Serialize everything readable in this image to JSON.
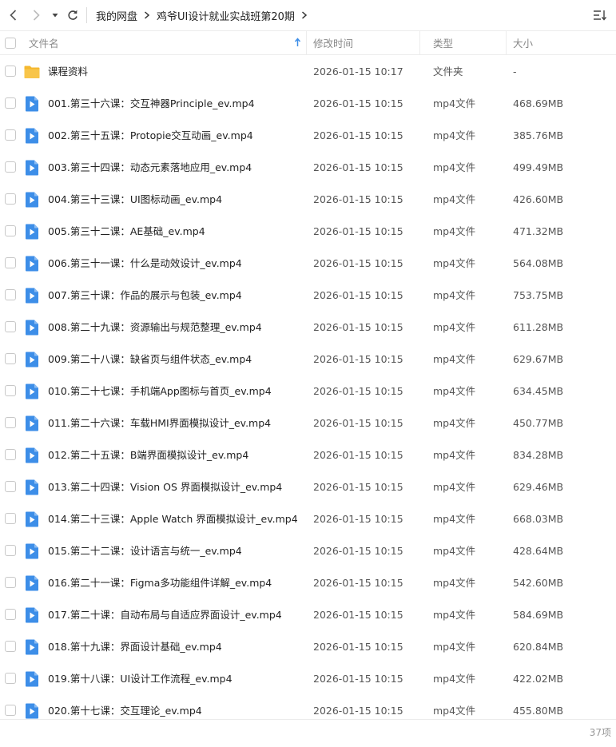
{
  "nav": {
    "back_icon": "chevron-left-icon",
    "forward_icon": "chevron-right-icon",
    "dropdown_icon": "caret-down-icon",
    "refresh_icon": "refresh-icon",
    "sort_icon": "sort-list-icon"
  },
  "breadcrumb": {
    "items": [
      "我的网盘",
      "鸡爷UI设计就业实战班第20期"
    ]
  },
  "columns": {
    "name": "文件名",
    "time": "修改时间",
    "type": "类型",
    "size": "大小"
  },
  "colors": {
    "folder": "#f5b82e",
    "video": "#3d8ee8",
    "sort_arrow": "#3d8ee8"
  },
  "files": [
    {
      "name": "课程资料",
      "time": "2026-01-15 10:17",
      "type": "文件夹",
      "size": "-",
      "icon": "folder-icon"
    },
    {
      "name": "001.第三十六课：交互神器Principle_ev.mp4",
      "time": "2026-01-15 10:15",
      "type": "mp4文件",
      "size": "468.69MB",
      "icon": "video-file-icon"
    },
    {
      "name": "002.第三十五课：Protopie交互动画_ev.mp4",
      "time": "2026-01-15 10:15",
      "type": "mp4文件",
      "size": "385.76MB",
      "icon": "video-file-icon"
    },
    {
      "name": "003.第三十四课：动态元素落地应用_ev.mp4",
      "time": "2026-01-15 10:15",
      "type": "mp4文件",
      "size": "499.49MB",
      "icon": "video-file-icon"
    },
    {
      "name": "004.第三十三课：UI图标动画_ev.mp4",
      "time": "2026-01-15 10:15",
      "type": "mp4文件",
      "size": "426.60MB",
      "icon": "video-file-icon"
    },
    {
      "name": "005.第三十二课：AE基础_ev.mp4",
      "time": "2026-01-15 10:15",
      "type": "mp4文件",
      "size": "471.32MB",
      "icon": "video-file-icon"
    },
    {
      "name": "006.第三十一课：什么是动效设计_ev.mp4",
      "time": "2026-01-15 10:15",
      "type": "mp4文件",
      "size": "564.08MB",
      "icon": "video-file-icon"
    },
    {
      "name": "007.第三十课：作品的展示与包装_ev.mp4",
      "time": "2026-01-15 10:15",
      "type": "mp4文件",
      "size": "753.75MB",
      "icon": "video-file-icon"
    },
    {
      "name": "008.第二十九课：资源输出与规范整理_ev.mp4",
      "time": "2026-01-15 10:15",
      "type": "mp4文件",
      "size": "611.28MB",
      "icon": "video-file-icon"
    },
    {
      "name": "009.第二十八课：缺省页与组件状态_ev.mp4",
      "time": "2026-01-15 10:15",
      "type": "mp4文件",
      "size": "629.67MB",
      "icon": "video-file-icon"
    },
    {
      "name": "010.第二十七课：手机端App图标与首页_ev.mp4",
      "time": "2026-01-15 10:15",
      "type": "mp4文件",
      "size": "634.45MB",
      "icon": "video-file-icon"
    },
    {
      "name": "011.第二十六课：车载HMI界面模拟设计_ev.mp4",
      "time": "2026-01-15 10:15",
      "type": "mp4文件",
      "size": "450.77MB",
      "icon": "video-file-icon"
    },
    {
      "name": "012.第二十五课：B端界面模拟设计_ev.mp4",
      "time": "2026-01-15 10:15",
      "type": "mp4文件",
      "size": "834.28MB",
      "icon": "video-file-icon"
    },
    {
      "name": "013.第二十四课：Vision OS 界面模拟设计_ev.mp4",
      "time": "2026-01-15 10:15",
      "type": "mp4文件",
      "size": "629.46MB",
      "icon": "video-file-icon"
    },
    {
      "name": "014.第二十三课：Apple Watch 界面模拟设计_ev.mp4",
      "time": "2026-01-15 10:15",
      "type": "mp4文件",
      "size": "668.03MB",
      "icon": "video-file-icon"
    },
    {
      "name": "015.第二十二课：设计语言与统一_ev.mp4",
      "time": "2026-01-15 10:15",
      "type": "mp4文件",
      "size": "428.64MB",
      "icon": "video-file-icon"
    },
    {
      "name": "016.第二十一课：Figma多功能组件详解_ev.mp4",
      "time": "2026-01-15 10:15",
      "type": "mp4文件",
      "size": "542.60MB",
      "icon": "video-file-icon"
    },
    {
      "name": "017.第二十课：自动布局与自适应界面设计_ev.mp4",
      "time": "2026-01-15 10:15",
      "type": "mp4文件",
      "size": "584.69MB",
      "icon": "video-file-icon"
    },
    {
      "name": "018.第十九课：界面设计基础_ev.mp4",
      "time": "2026-01-15 10:15",
      "type": "mp4文件",
      "size": "620.84MB",
      "icon": "video-file-icon"
    },
    {
      "name": "019.第十八课：UI设计工作流程_ev.mp4",
      "time": "2026-01-15 10:15",
      "type": "mp4文件",
      "size": "422.02MB",
      "icon": "video-file-icon"
    },
    {
      "name": "020.第十七课：交互理论_ev.mp4",
      "time": "2026-01-15 10:15",
      "type": "mp4文件",
      "size": "455.80MB",
      "icon": "video-file-icon"
    }
  ],
  "footer": {
    "count": "37项"
  }
}
